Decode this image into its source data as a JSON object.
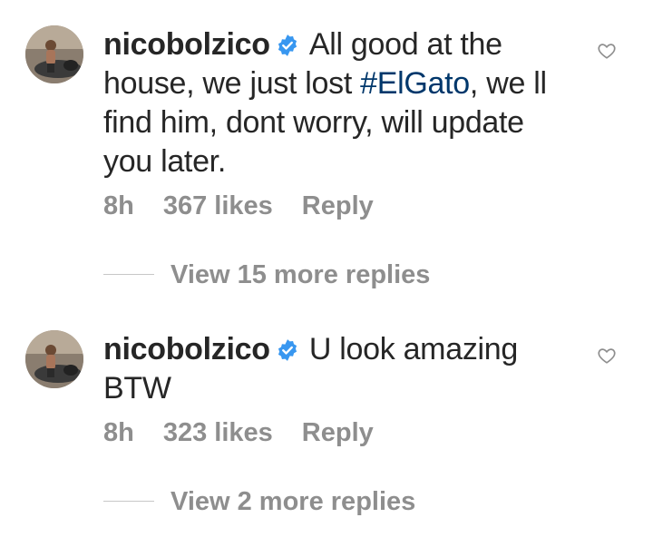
{
  "comments": [
    {
      "username": "nicobolzico",
      "text_before": "All good at the house, we just lost ",
      "hashtag": "#ElGato",
      "text_after": ", we ll find him, dont worry, will update you later.",
      "time": "8h",
      "likes": "367 likes",
      "reply_label": "Reply",
      "view_replies": "View 15 more replies"
    },
    {
      "username": "nicobolzico",
      "text_before": "U look amazing BTW",
      "hashtag": "",
      "text_after": "",
      "time": "8h",
      "likes": "323 likes",
      "reply_label": "Reply",
      "view_replies": "View 2 more replies"
    }
  ],
  "icons": {
    "verified": "verified-badge-icon",
    "like": "heart-outline-icon"
  },
  "colors": {
    "text": "#262626",
    "secondary": "#8e8e8e",
    "hashtag": "#00376b",
    "verified": "#3897f0"
  }
}
